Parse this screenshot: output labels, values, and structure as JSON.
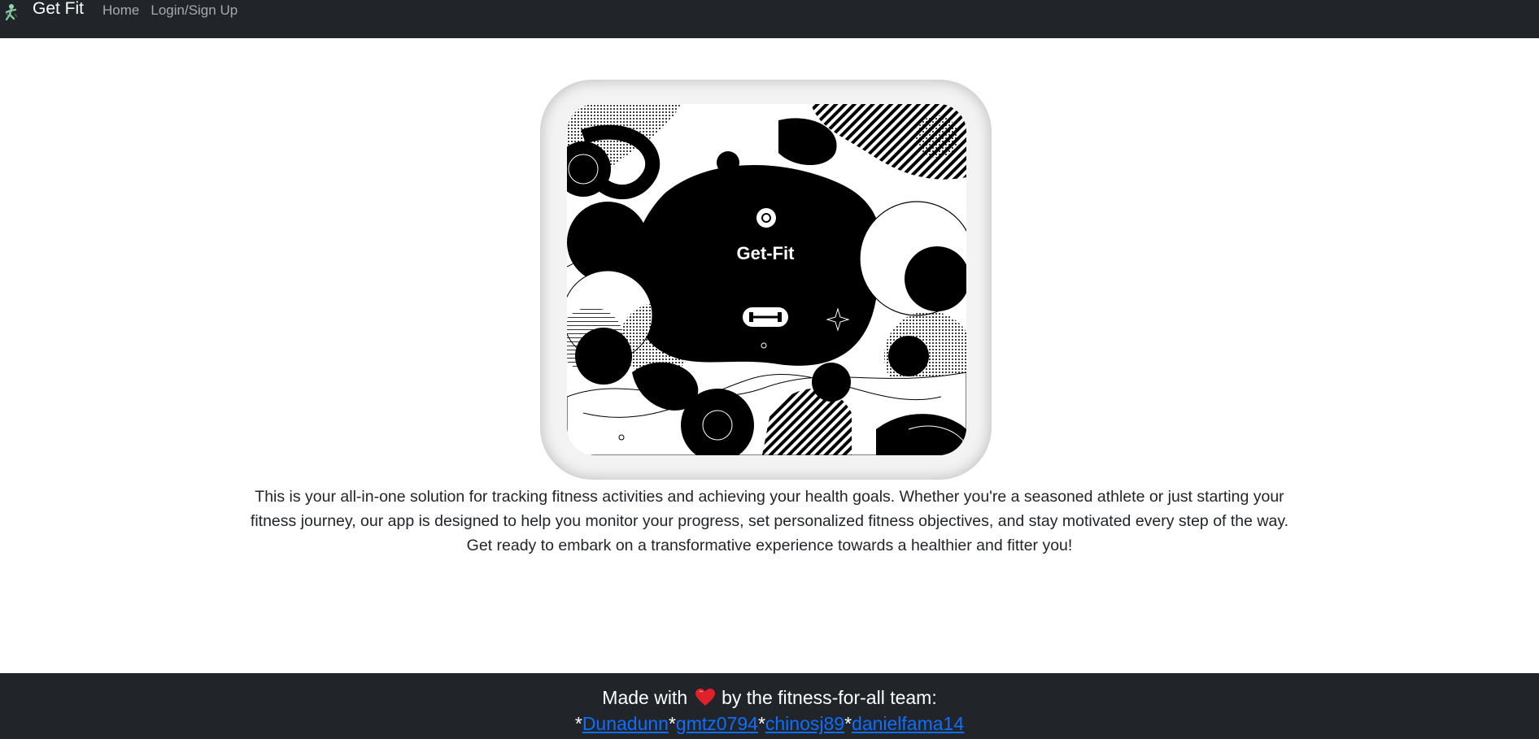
{
  "navbar": {
    "brand": "Get Fit",
    "links": [
      "Home",
      "Login/Sign Up"
    ]
  },
  "hero": {
    "image_text": "Get-Fit"
  },
  "intro_text": "This is your all-in-one solution for tracking fitness activities and achieving your health goals. Whether you're a seasoned athlete or just starting your fitness journey, our app is designed to help you monitor your progress, set personalized fitness objectives, and stay motivated every step of the way. Get ready to embark on a transformative experience towards a healthier and fitter you!",
  "footer": {
    "made_with": "Made with",
    "by_team": "by the fitness-for-all team:",
    "separator": "*",
    "contributors": [
      "Dunadunn",
      "gmtz0794",
      "chinosj89",
      "danielfama14"
    ]
  },
  "colors": {
    "navbar_bg": "#212529",
    "link": "#0d6efd",
    "heart": "#e0202a"
  }
}
